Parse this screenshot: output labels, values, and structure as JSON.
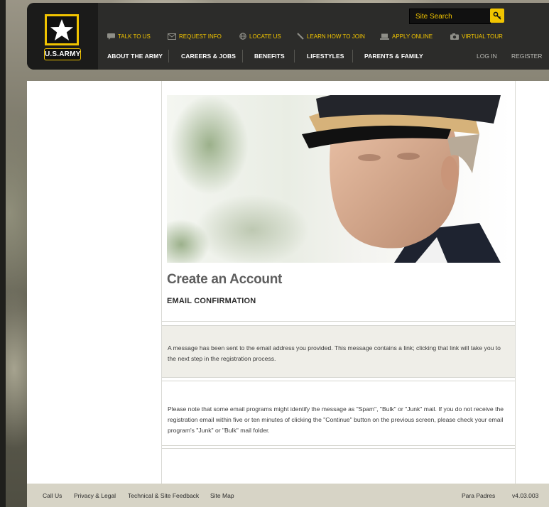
{
  "header": {
    "logo_text": "U.S.ARMY",
    "search": {
      "placeholder": "Site Search"
    },
    "utility_links": [
      {
        "label": "TALK TO US",
        "icon": "chat-icon"
      },
      {
        "label": "REQUEST INFO",
        "icon": "envelope-icon"
      },
      {
        "label": "LOCATE US",
        "icon": "globe-icon"
      },
      {
        "label": "LEARN HOW TO JOIN",
        "icon": "pencil-icon"
      },
      {
        "label": "APPLY ONLINE",
        "icon": "laptop-icon"
      },
      {
        "label": "VIRTUAL TOUR",
        "icon": "camera-icon"
      }
    ],
    "nav": [
      "ABOUT THE ARMY",
      "CAREERS & JOBS",
      "BENEFITS",
      "LIFESTYLES",
      "PARENTS & FAMILY"
    ],
    "account": {
      "login": "LOG IN",
      "register": "REGISTER"
    }
  },
  "main": {
    "title": "Create an Account",
    "subtitle": "EMAIL CONFIRMATION",
    "message": "A message has been sent to the email address you provided. This message contains a link; clicking that link will take you to the next step in the registration process.",
    "note": "Please note that some email programs might identify the message as \"Spam\", \"Bulk\" or \"Junk\" mail. If you do not receive the registration email within five or ten minutes of clicking the \"Continue\" button on the previous screen, please check your email program's \"Junk\" or \"Bulk\" mail folder."
  },
  "footer": {
    "links": [
      "Call Us",
      "Privacy & Legal",
      "Technical & Site Feedback",
      "Site Map"
    ],
    "spanish": "Para Padres",
    "version": "v4.03.003"
  },
  "colors": {
    "accent_gold": "#f1c400",
    "header_bg": "#2c2c2a",
    "footer_bg": "#d7d4c6",
    "message_bg": "#efeee8"
  }
}
